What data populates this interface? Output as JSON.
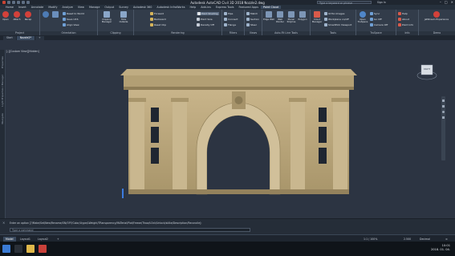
{
  "window": {
    "title": "Autodesk AutoCAD Civil 3D 2018   Nozzle2.dwg",
    "search_placeholder": "Type a keyword or phrase",
    "user_label": "Sign In"
  },
  "menu": [
    "Home",
    "Insert",
    "Annotate",
    "Modify",
    "Analyze",
    "View",
    "Manage",
    "Output",
    "Survey",
    "Autodesk 360",
    "Autodesk InfraWorks",
    "Help",
    "Add-ins",
    "Express Tools",
    "Featured Apps",
    "Point Cloud"
  ],
  "menu_active_index": 15,
  "ribbon": {
    "panels": [
      {
        "label": "Project",
        "buttons": [
          "Open",
          "Attach",
          "Recap"
        ]
      },
      {
        "label": "Orientation",
        "buttons": [
          "Reset to World",
          "Save UCS",
          "Align View"
        ]
      },
      {
        "label": "Clipping",
        "buttons": [
          "Clipping Manager",
          "Hide Outside"
        ]
      },
      {
        "label": "Rendering",
        "buttons": [
          "Forward",
          "Backward",
          "Reset Clip",
          "Point Shading",
          "Point Size",
          "Density Off"
        ]
      },
      {
        "label": "Filters",
        "buttons": [
          "Pipe",
          "Connect",
          "Flange"
        ]
      },
      {
        "label": "Views",
        "buttons": [
          "Match",
          "Section",
          "Steel"
        ]
      },
      {
        "label": "Auto-Fit Line Tools",
        "buttons": [
          "Edge Wall",
          "Wall Pointer",
          "Planar Polyline",
          "Polygon"
        ]
      },
      {
        "label": "Tools",
        "buttons": [
          "Cloud Manager",
          "Ortho Images",
          "Workplane on/off",
          "SmartPick Viewport"
        ]
      },
      {
        "label": "TruSpace",
        "buttons": [
          "Open TruSpace",
          "Sync",
          "Go Off",
          "Camera Off"
        ]
      },
      {
        "label": "Info",
        "buttons": [
          "Help",
          "About",
          "Point Info"
        ]
      },
      {
        "label": "Demo",
        "buttons": [
          "JetStream Experience"
        ]
      }
    ]
  },
  "file_tabs": [
    "Start",
    "Nozzle2*"
  ],
  "active_file_tab": 1,
  "viewport": {
    "label": "[-][Custom View][Hidden]",
    "viewcube_label": "RIGHT"
  },
  "left_palette": [
    "Properties",
    "Light Properties / Manager",
    "Navigate"
  ],
  "command_line": {
    "history": "Enter an option [?/Make/Set/New/Rename/ON/OFF/Color/Ltype/LWeight/TRansparency/MATerial/Plot/Freeze/Thaw/LOck/Unlock/stAte/Description/Reconcile]:",
    "placeholder": "Type a command"
  },
  "status": {
    "layout_tabs": [
      "Model",
      "Layout1",
      "Layout2"
    ],
    "active_layout": 0,
    "scale": "1:1 / 100%",
    "coord": "2.500",
    "units": "Decimal"
  },
  "taskbar": {
    "time": "10:01",
    "date": "2018. 01. 04."
  },
  "colors": {
    "accent": "#3a4a5f",
    "viewport_bg": "#2c3442",
    "stone": "#b9a57a"
  }
}
